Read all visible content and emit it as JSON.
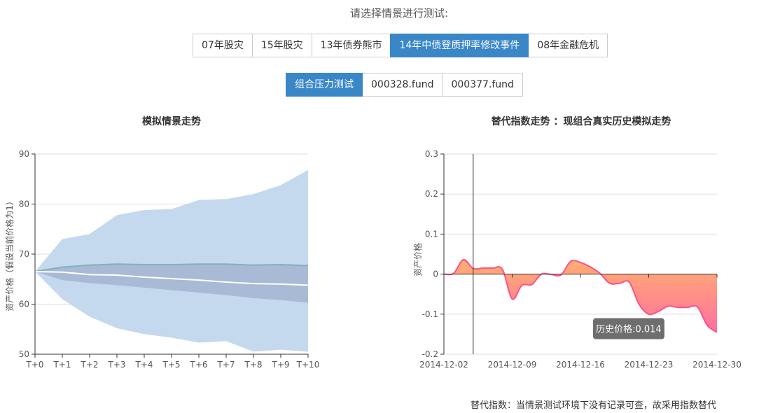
{
  "prompt": "请选择情景进行测试:",
  "scenarios": [
    {
      "label": "07年股灾",
      "active": false
    },
    {
      "label": "15年股灾",
      "active": false
    },
    {
      "label": "13年债券熊市",
      "active": false
    },
    {
      "label": "14年中债登质押率修改事件",
      "active": true
    },
    {
      "label": "08年金融危机",
      "active": false
    }
  ],
  "funds": [
    {
      "label": "组合压力测试",
      "active": true
    },
    {
      "label": "000328.fund",
      "active": false
    },
    {
      "label": "000377.fund",
      "active": false
    }
  ],
  "colors": {
    "accent": "#3a87c8",
    "outer_band": "#c4d9ee",
    "inner_band": "#a9bad6",
    "median_line": "#7fb3b8",
    "mean_line": "#ffffff",
    "area_top": "#ffb070",
    "area_bottom": "#ff6fa0",
    "area_line": "#ff4f88",
    "tooltip_bg": "#666666"
  },
  "chart_data": [
    {
      "type": "area",
      "title": "模拟情景走势",
      "xlabel": "",
      "ylabel": "资产价格（假设当前价格为1）",
      "categories": [
        "T+0",
        "T+1",
        "T+2",
        "T+3",
        "T+4",
        "T+5",
        "T+6",
        "T+7",
        "T+8",
        "T+9",
        "T+10"
      ],
      "ylim": [
        50,
        90
      ],
      "yticks": [
        50,
        60,
        70,
        80,
        90
      ],
      "grid": true,
      "series": [
        {
          "role": "outer_upper",
          "values": [
            66.5,
            73.0,
            74.0,
            77.8,
            78.8,
            79.0,
            80.8,
            81.0,
            82.0,
            83.8,
            86.8
          ]
        },
        {
          "role": "outer_lower",
          "values": [
            66.5,
            61.0,
            57.5,
            55.2,
            54.0,
            53.3,
            52.3,
            52.6,
            50.5,
            50.9,
            50.5
          ]
        },
        {
          "role": "inner_upper",
          "values": [
            66.5,
            67.5,
            67.8,
            68.0,
            67.9,
            67.9,
            68.0,
            68.0,
            67.8,
            67.9,
            67.8
          ]
        },
        {
          "role": "inner_lower",
          "values": [
            66.5,
            64.8,
            64.2,
            63.8,
            63.3,
            62.8,
            62.3,
            61.8,
            61.2,
            60.8,
            60.3
          ]
        },
        {
          "role": "median",
          "values": [
            66.5,
            67.4,
            67.8,
            68.0,
            67.9,
            67.9,
            68.0,
            68.0,
            67.8,
            67.9,
            67.7
          ]
        },
        {
          "role": "mean",
          "values": [
            66.5,
            66.4,
            65.9,
            65.8,
            65.4,
            65.1,
            64.8,
            64.4,
            64.1,
            64.0,
            63.8
          ]
        }
      ]
    },
    {
      "type": "area",
      "title": "替代指数走势 ：现组合真实历史模拟走势",
      "xlabel": "",
      "ylabel": "资产价格",
      "ylim": [
        -0.2,
        0.3
      ],
      "yticks": [
        -0.2,
        -0.1,
        0,
        0.1,
        0.2,
        0.3
      ],
      "xlim": [
        "2014-12-02",
        "2014-12-30"
      ],
      "xticks": [
        "2014-12-02",
        "2014-12-09",
        "2014-12-16",
        "2014-12-23",
        "2014-12-30"
      ],
      "grid": true,
      "points": [
        {
          "x": "2014-12-02",
          "y": 0.0
        },
        {
          "x": "2014-12-03",
          "y": 0.002
        },
        {
          "x": "2014-12-04",
          "y": 0.036
        },
        {
          "x": "2014-12-05",
          "y": 0.014
        },
        {
          "x": "2014-12-06",
          "y": 0.015
        },
        {
          "x": "2014-12-07",
          "y": 0.015
        },
        {
          "x": "2014-12-08",
          "y": 0.012
        },
        {
          "x": "2014-12-09",
          "y": -0.062
        },
        {
          "x": "2014-12-10",
          "y": -0.028
        },
        {
          "x": "2014-12-11",
          "y": -0.026
        },
        {
          "x": "2014-12-12",
          "y": 0.0
        },
        {
          "x": "2014-12-13",
          "y": -0.001
        },
        {
          "x": "2014-12-14",
          "y": -0.002
        },
        {
          "x": "2014-12-15",
          "y": 0.032
        },
        {
          "x": "2014-12-16",
          "y": 0.029
        },
        {
          "x": "2014-12-17",
          "y": 0.018
        },
        {
          "x": "2014-12-18",
          "y": 0.002
        },
        {
          "x": "2014-12-19",
          "y": -0.023
        },
        {
          "x": "2014-12-20",
          "y": -0.023
        },
        {
          "x": "2014-12-21",
          "y": -0.02
        },
        {
          "x": "2014-12-22",
          "y": -0.075
        },
        {
          "x": "2014-12-23",
          "y": -0.1
        },
        {
          "x": "2014-12-24",
          "y": -0.093
        },
        {
          "x": "2014-12-25",
          "y": -0.08
        },
        {
          "x": "2014-12-26",
          "y": -0.083
        },
        {
          "x": "2014-12-27",
          "y": -0.083
        },
        {
          "x": "2014-12-28",
          "y": -0.082
        },
        {
          "x": "2014-12-29",
          "y": -0.128
        },
        {
          "x": "2014-12-30",
          "y": -0.145
        }
      ],
      "cursor_x": "2014-12-05",
      "tooltip": "历史价格:0.014"
    }
  ],
  "footnote": "替代指数：当情景测试环境下没有记录可查，故采用指数替代"
}
